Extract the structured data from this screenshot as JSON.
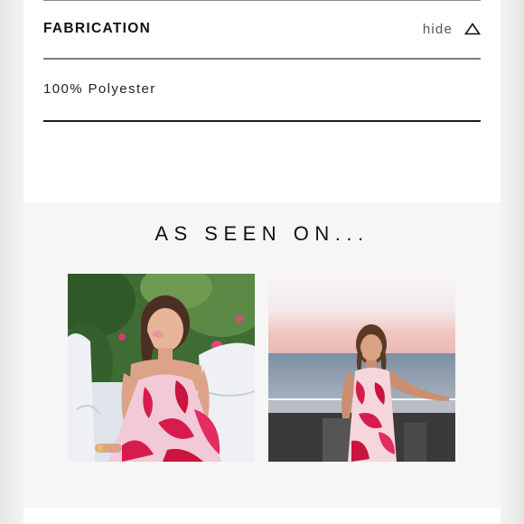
{
  "fabrication": {
    "title": "FABRICATION",
    "toggle_label": "hide",
    "toggle_icon": "triangle-up-icon",
    "content": "100% Polyester"
  },
  "as_seen_on": {
    "heading": "AS SEEN ON...",
    "photos": [
      {
        "name": "influencer-photo-1",
        "description_icon": "photo"
      },
      {
        "name": "influencer-photo-2",
        "description_icon": "photo"
      }
    ]
  },
  "colors": {
    "panel": "#ffffff",
    "section_bg": "#f6f6f6",
    "text": "#111111",
    "muted": "#555555",
    "dress_pink": "#d81b4f"
  }
}
